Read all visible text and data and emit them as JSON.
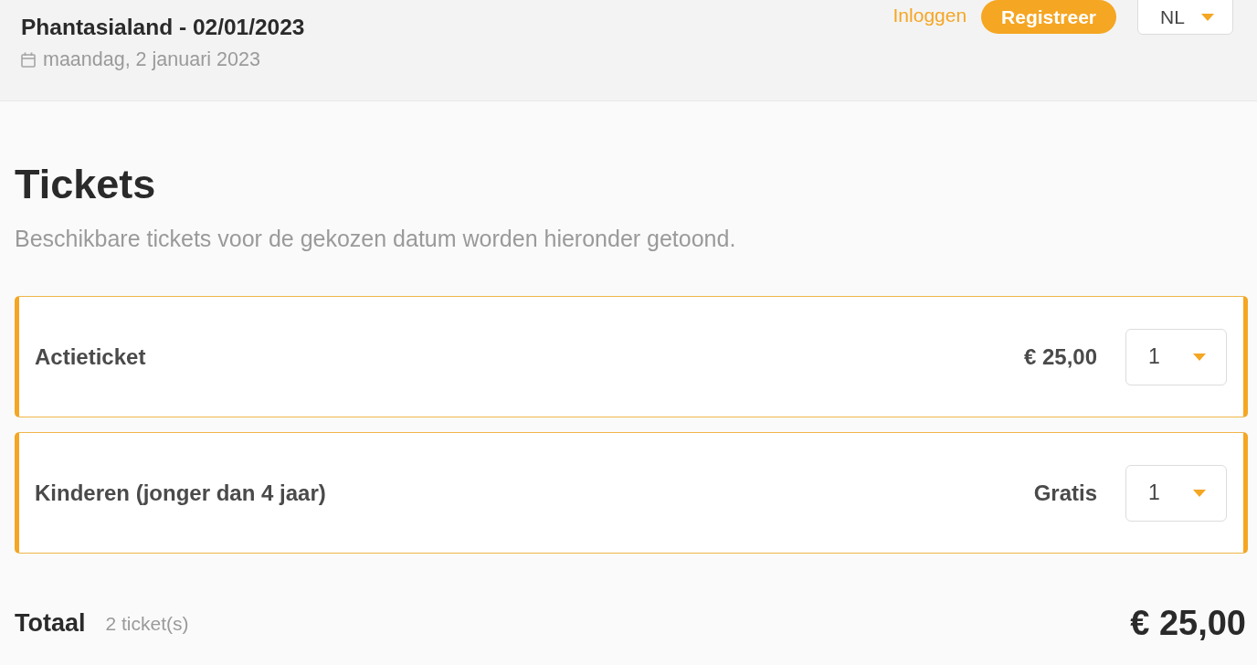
{
  "header": {
    "title": "Phantasialand - 02/01/2023",
    "date": "maandag, 2 januari 2023",
    "login_link": "Inloggen",
    "register_button": "Registreer",
    "language": {
      "value": "NL"
    }
  },
  "tickets": {
    "heading": "Tickets",
    "subtitle": "Beschikbare tickets voor de gekozen datum worden hieronder getoond.",
    "items": [
      {
        "name": "Actieticket",
        "price": "€ 25,00",
        "quantity": "1"
      },
      {
        "name": "Kinderen (jonger dan 4 jaar)",
        "price": "Gratis",
        "quantity": "1"
      }
    ]
  },
  "total": {
    "label": "Totaal",
    "count": "2 ticket(s)",
    "amount": "€ 25,00"
  }
}
